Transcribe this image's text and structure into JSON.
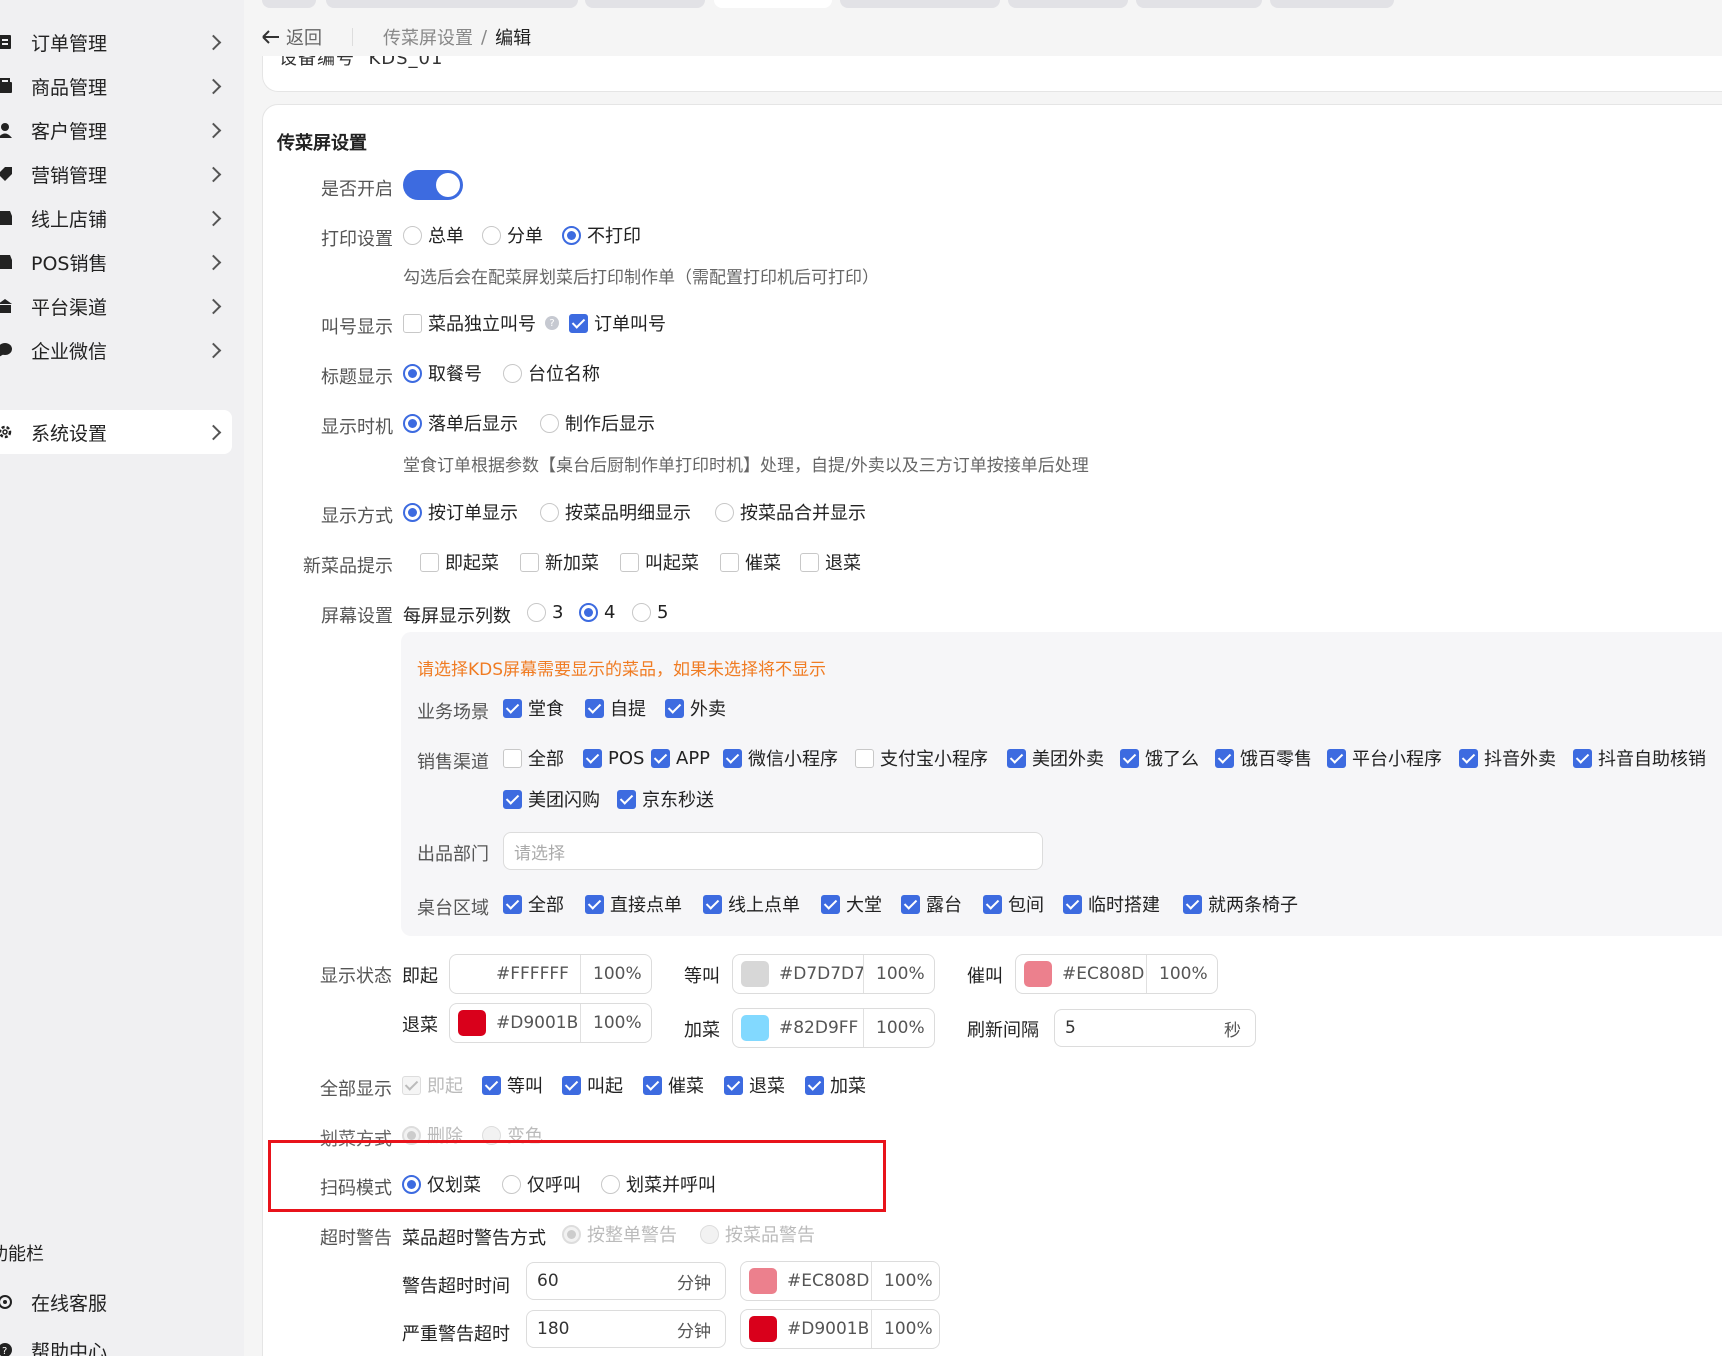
{
  "sidebar": {
    "items": [
      {
        "label": "订单管理",
        "icon": "order-icon"
      },
      {
        "label": "商品管理",
        "icon": "goods-icon"
      },
      {
        "label": "客户管理",
        "icon": "user-icon"
      },
      {
        "label": "营销管理",
        "icon": "tag-icon"
      },
      {
        "label": "线上店铺",
        "icon": "store-icon"
      },
      {
        "label": "POS销售",
        "icon": "pos-icon"
      },
      {
        "label": "平台渠道",
        "icon": "bank-icon"
      },
      {
        "label": "企业微信",
        "icon": "chat-icon"
      },
      {
        "label": "系统设置",
        "icon": "gear-icon"
      }
    ],
    "section_label": "功能栏",
    "bottom_items": [
      {
        "label": "在线客服",
        "icon": "headset-icon"
      },
      {
        "label": "帮助中心",
        "icon": "help-icon"
      }
    ]
  },
  "breadcrumb": {
    "back": "返回",
    "parent": "传菜屏设置",
    "separator": "/",
    "current": "编辑"
  },
  "device": {
    "label": "设备编号",
    "value": "KDS_01"
  },
  "form": {
    "section_title": "传菜屏设置",
    "enable": {
      "label": "是否开启",
      "on": true
    },
    "print": {
      "label": "打印设置",
      "options": [
        "总单",
        "分单",
        "不打印"
      ],
      "selected": "不打印",
      "hint": "勾选后会在配菜屏划菜后打印制作单（需配置打印机后可打印）"
    },
    "call": {
      "label": "叫号显示",
      "options": [
        {
          "text": "菜品独立叫号",
          "checked": false
        },
        {
          "text": "订单叫号",
          "checked": true
        }
      ]
    },
    "title_show": {
      "label": "标题显示",
      "options": [
        "取餐号",
        "台位名称"
      ],
      "selected": "取餐号"
    },
    "timing": {
      "label": "显示时机",
      "options": [
        "落单后显示",
        "制作后显示"
      ],
      "selected": "落单后显示",
      "hint": "堂食订单根据参数【桌台后厨制作单打印时机】处理，自提/外卖以及三方订单按接单后处理"
    },
    "mode": {
      "label": "显示方式",
      "options": [
        "按订单显示",
        "按菜品明细显示",
        "按菜品合并显示"
      ],
      "selected": "按订单显示"
    },
    "new_tip": {
      "label": "新菜品提示",
      "options": [
        "即起菜",
        "新加菜",
        "叫起菜",
        "催菜",
        "退菜"
      ]
    },
    "screen": {
      "label": "屏幕设置",
      "sub": "每屏显示列数",
      "options": [
        "3",
        "4",
        "5"
      ],
      "selected": "4",
      "warn": "请选择KDS屏幕需要显示的菜品，如果未选择将不显示",
      "scene": {
        "label": "业务场景",
        "options": [
          "堂食",
          "自提",
          "外卖"
        ]
      },
      "channel": {
        "label": "销售渠道",
        "options": [
          {
            "text": "全部",
            "checked": false
          },
          {
            "text": "POS",
            "checked": true
          },
          {
            "text": "APP",
            "checked": true
          },
          {
            "text": "微信小程序",
            "checked": true
          },
          {
            "text": "支付宝小程序",
            "checked": false
          },
          {
            "text": "美团外卖",
            "checked": true
          },
          {
            "text": "饿了么",
            "checked": true
          },
          {
            "text": "饿百零售",
            "checked": true
          },
          {
            "text": "平台小程序",
            "checked": true
          },
          {
            "text": "抖音外卖",
            "checked": true
          },
          {
            "text": "抖音自助核销",
            "checked": true
          },
          {
            "text": "美团闪购",
            "checked": true
          },
          {
            "text": "京东秒送",
            "checked": true
          }
        ]
      },
      "dept": {
        "label": "出品部门",
        "placeholder": "请选择"
      },
      "area": {
        "label": "桌台区域",
        "options": [
          "全部",
          "直接点单",
          "线上点单",
          "大堂",
          "露台",
          "包间",
          "临时搭建",
          "就两条椅子"
        ]
      }
    },
    "status": {
      "label": "显示状态",
      "colors": [
        {
          "name": "即起",
          "hex": "#FFFFFF",
          "pct": "100%"
        },
        {
          "name": "等叫",
          "hex": "#D7D7D7",
          "pct": "100%"
        },
        {
          "name": "催叫",
          "hex": "#EC808D",
          "pct": "100%"
        },
        {
          "name": "退菜",
          "hex": "#D9001B",
          "pct": "100%"
        },
        {
          "name": "加菜",
          "hex": "#82D9FF",
          "pct": "100%"
        }
      ],
      "refresh": {
        "label": "刷新间隔",
        "value": "5",
        "unit": "秒"
      }
    },
    "all_show": {
      "label": "全部显示",
      "options": [
        "即起",
        "等叫",
        "叫起",
        "催菜",
        "退菜",
        "加菜"
      ]
    },
    "strike": {
      "label": "划菜方式",
      "options": [
        "删除",
        "变色"
      ]
    },
    "scan": {
      "label": "扫码模式",
      "options": [
        "仅划菜",
        "仅呼叫",
        "划菜并呼叫"
      ],
      "selected": "仅划菜"
    },
    "timeout": {
      "label": "超时警告",
      "sub": "菜品超时警告方式",
      "options": [
        "按整单警告",
        "按菜品警告"
      ],
      "warn1": {
        "label": "警告超时时间",
        "value": "60",
        "unit": "分钟",
        "hex": "#EC808D",
        "pct": "100%"
      },
      "warn2": {
        "label": "严重警告超时",
        "value": "180",
        "unit": "分钟",
        "hex": "#D9001B",
        "pct": "100%"
      }
    }
  },
  "colors": {
    "accent": "#3D6BE0",
    "highlight_frame": "#E8131B",
    "warn_text": "#F07C23"
  }
}
